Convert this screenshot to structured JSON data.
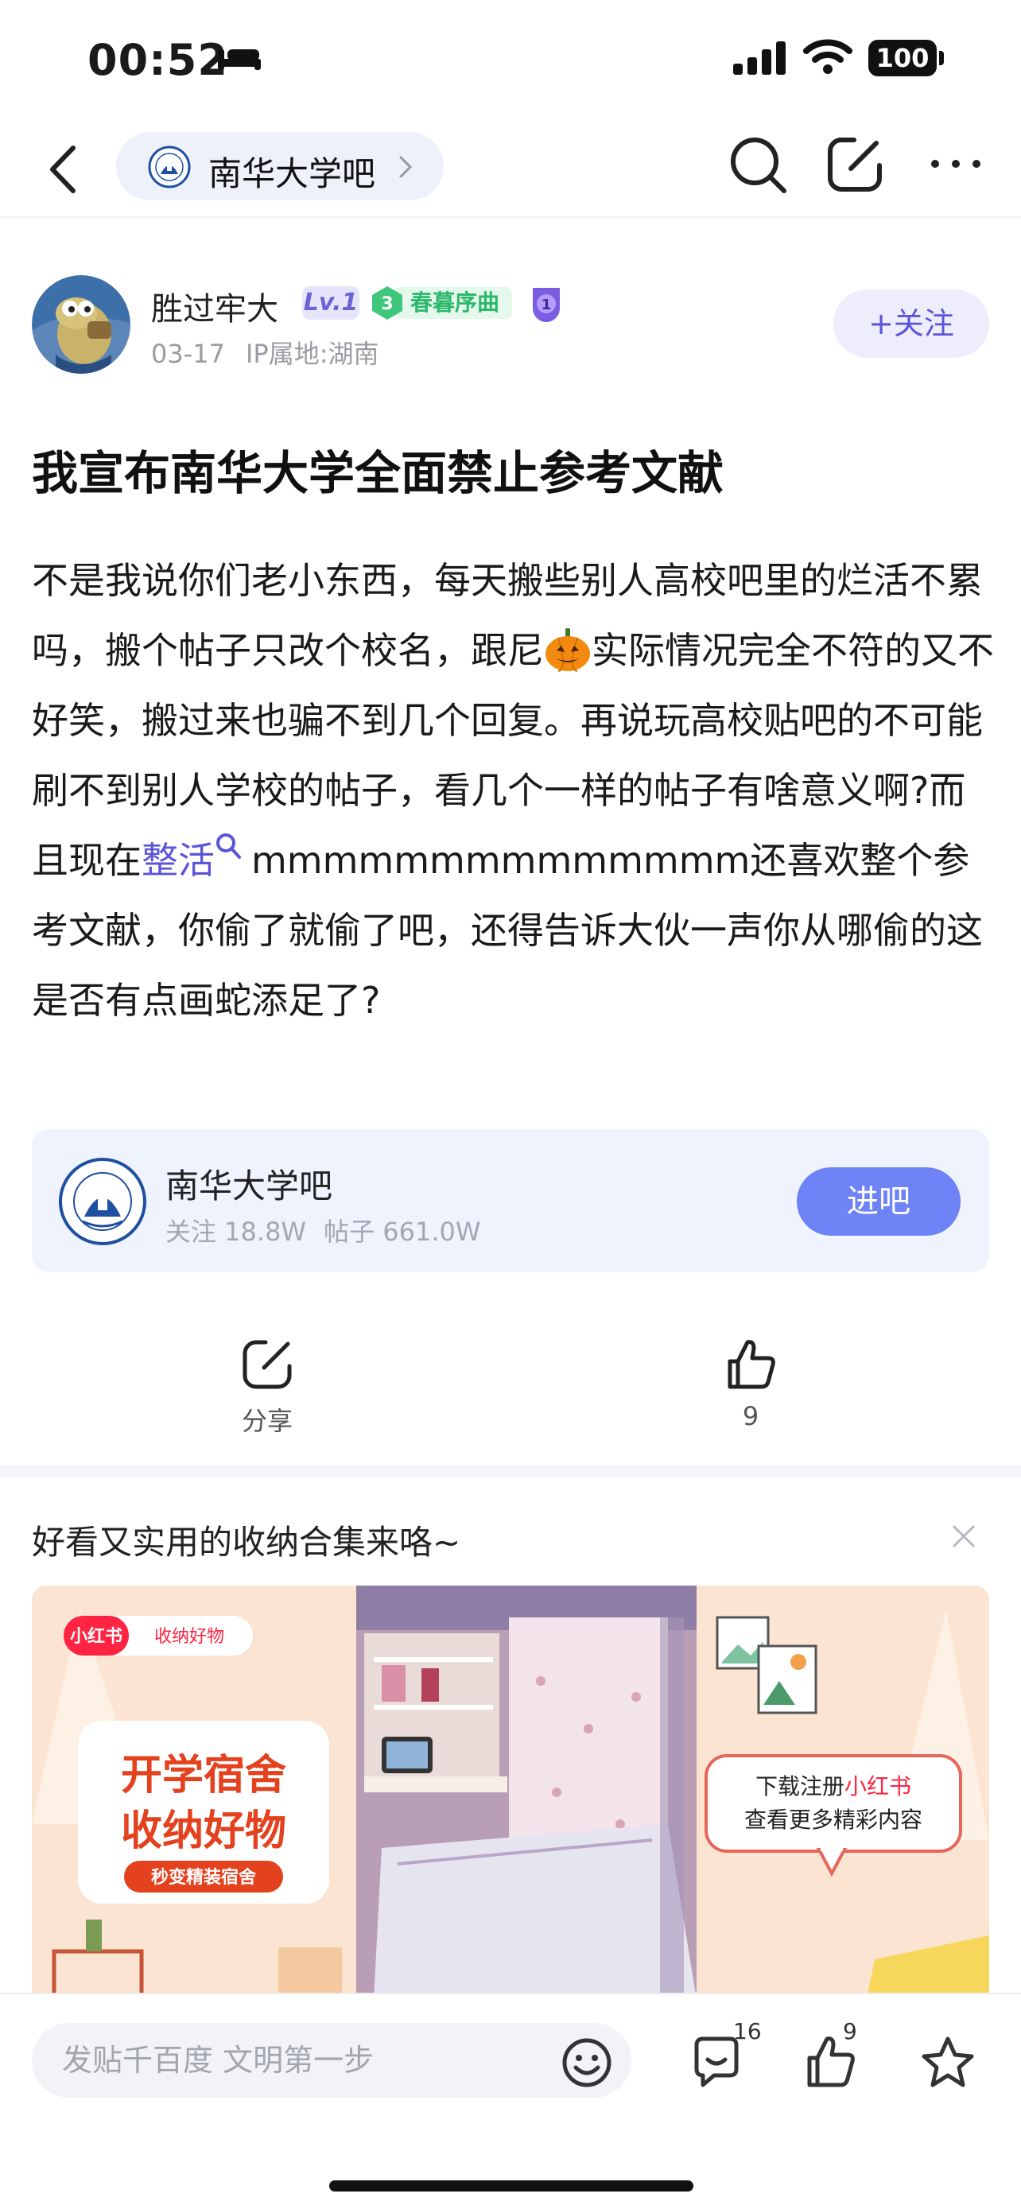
{
  "status": {
    "time": "00:52",
    "battery": "100"
  },
  "nav": {
    "bar_name": "南华大学吧"
  },
  "post": {
    "author": "胜过牢大",
    "level": "Lv.1",
    "badge_number": "3",
    "badge_text": "春暮序曲",
    "medal_number": "1",
    "date": "03-17",
    "ip": "IP属地:湖南",
    "follow_label": "+关注",
    "title": "我宣布南华大学全面禁止参考文献",
    "body_1": "不是我说你们老小东西，每天搬些别人高校吧里的烂活不累吗，搬个帖子只改个校名，跟尼",
    "body_2": "实际情况完全不符的又不好笑，搬过来也骗不到几个回复。再说玩高校贴吧的不可能刷不到别人学校的帖子，看几个一样的帖子有啥意义啊?而且现在",
    "body_link": "整活",
    "body_3": "mmmmmmmmmmmmmm还喜欢整个参考文献，你偷了就偷了吧，还得告诉大伙一声你从哪偷的这是否有点画蛇添足了?"
  },
  "forum_card": {
    "name": "南华大学吧",
    "followers": "关注 18.8W",
    "posts": "帖子 661.0W",
    "enter_label": "进吧"
  },
  "actions": {
    "share_label": "分享",
    "like_count": "9"
  },
  "ad": {
    "title": "好看又实用的收纳合集来咯~",
    "tag_brand": "小红书",
    "tag_text": "收纳好物",
    "headline_1": "开学宿舍",
    "headline_2": "收纳好物",
    "sub_ribbon": "秒变精装宿舍",
    "cta_1_prefix": "下载注册",
    "cta_1_brand": "小红书",
    "cta_2": "查看更多精彩内容"
  },
  "bottom": {
    "reply_placeholder": "发贴千百度 文明第一步",
    "comment_count": "16",
    "like_count": "9"
  },
  "colors": {
    "accent": "#5b55d8",
    "enter_button": "#6e83f5",
    "card_bg": "#eef3fd"
  }
}
